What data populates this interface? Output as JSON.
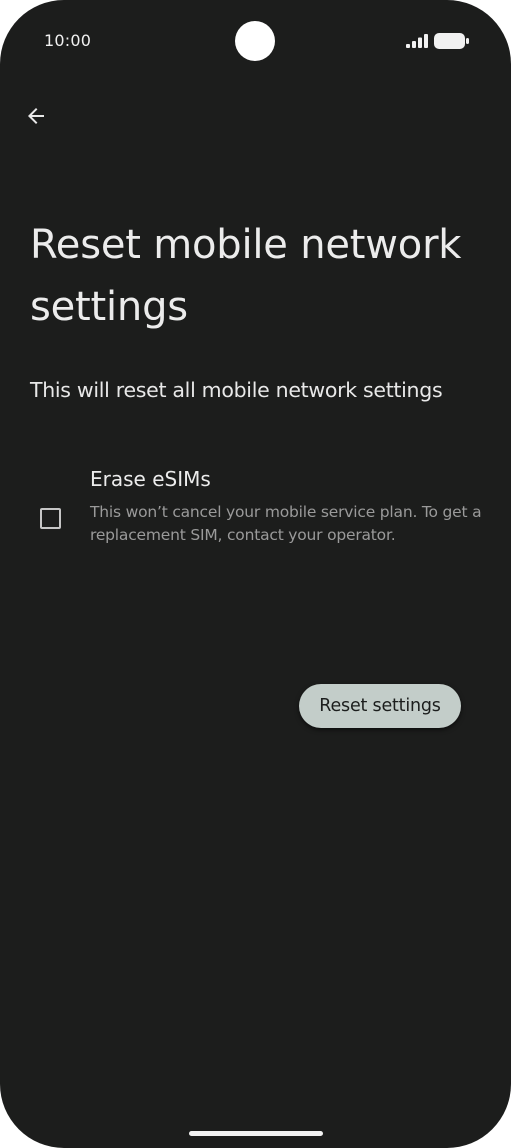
{
  "status_bar": {
    "time": "10:00",
    "signal_icon": "cellular-signal-full-icon",
    "battery_icon": "battery-full-icon"
  },
  "toolbar": {
    "back_icon": "arrow-back-icon"
  },
  "page": {
    "title": "Reset mobile network settings",
    "description": "This will reset all mobile network settings"
  },
  "esim_option": {
    "checked": false,
    "title": "Erase eSIMs",
    "summary": "This won’t cancel your mobile service plan. To get a replacement SIM, contact your operator."
  },
  "actions": {
    "reset_label": "Reset settings"
  },
  "colors": {
    "background": "#1c1d1c",
    "button_bg": "#c3cdc9",
    "text_primary": "#ececec",
    "text_secondary": "#9a9a9a"
  }
}
